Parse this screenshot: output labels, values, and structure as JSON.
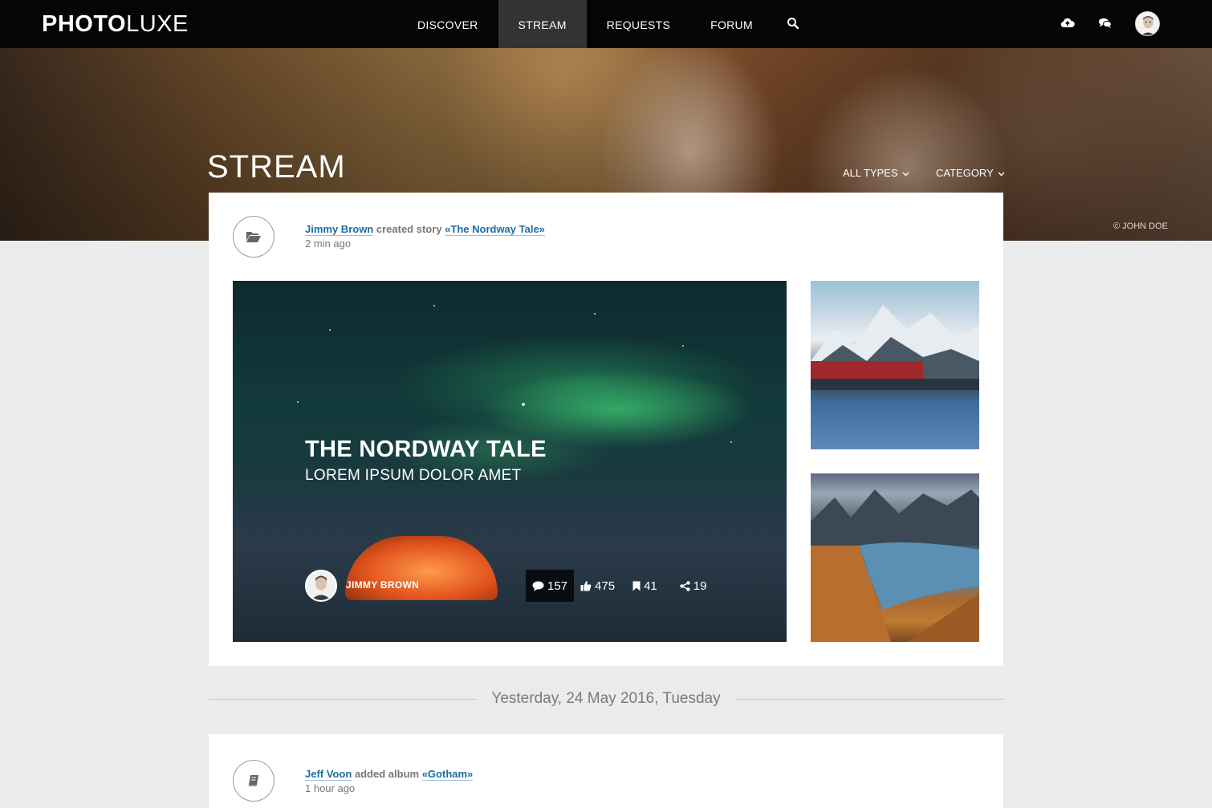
{
  "header": {
    "logo_bold": "PHOTO",
    "logo_light": "LUXE",
    "nav": [
      {
        "label": "DISCOVER",
        "active": false
      },
      {
        "label": "STREAM",
        "active": true
      },
      {
        "label": "REQUESTS",
        "active": false
      },
      {
        "label": "FORUM",
        "active": false
      }
    ],
    "icons": [
      "search-icon",
      "cloud-upload-icon",
      "chat-icon",
      "avatar"
    ]
  },
  "hero": {
    "title": "STREAM",
    "filter_types": "ALL TYPES",
    "filter_category": "CATEGORY",
    "credit": "© JOHN DOE"
  },
  "feed": [
    {
      "icon": "folder-open-icon",
      "user": "Jimmy Brown",
      "verb": "created story",
      "object": "«The Nordway Tale»",
      "time": "2 min ago",
      "feature": {
        "title": "THE NORDWAY TALE",
        "subtitle": "LOREM IPSUM DOLOR AMET",
        "author": "JIMMY BROWN",
        "stats": {
          "comments": "157",
          "likes": "475",
          "bookmarks": "41",
          "shares": "19"
        }
      }
    },
    {
      "icon": "book-icon",
      "user": "Jeff Voon",
      "verb": "added album",
      "object": "«Gotham»",
      "time": "1 hour ago"
    }
  ],
  "date_separator": "Yesterday, 24 May 2016, Tuesday",
  "colors": {
    "topbar": "#050505",
    "nav_active": "#333333",
    "link": "#1c6ea4",
    "page_bg": "#ebebeb"
  }
}
